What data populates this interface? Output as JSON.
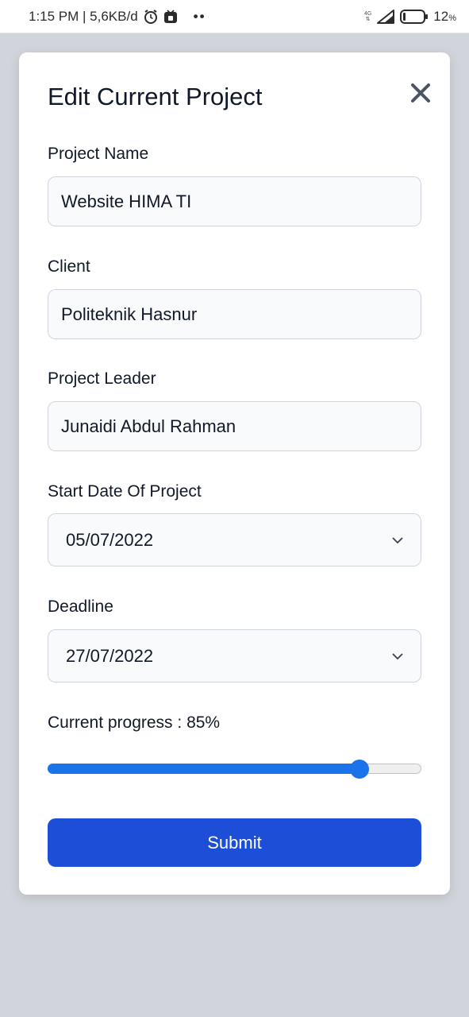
{
  "status_bar": {
    "time_speed": "1:15 PM | 5,6KB/d",
    "alarm_icon": "alarm-clock-icon",
    "app_icon": "notification-app-icon",
    "more_dots": "••",
    "network_label": "4G",
    "battery_percent": "12",
    "battery_unit": "%"
  },
  "dialog": {
    "title": "Edit Current Project",
    "close_icon": "close-icon"
  },
  "form": {
    "project_name": {
      "label": "Project Name",
      "value": "Website HIMA TI"
    },
    "client": {
      "label": "Client",
      "value": "Politeknik Hasnur"
    },
    "project_leader": {
      "label": "Project Leader",
      "value": "Junaidi Abdul Rahman"
    },
    "start_date": {
      "label": "Start Date Of Project",
      "value": "05/07/2022"
    },
    "deadline": {
      "label": "Deadline",
      "value": "27/07/2022"
    },
    "progress": {
      "label": "Current progress : 85%",
      "value_percent": 85
    },
    "submit_label": "Submit"
  },
  "colors": {
    "accent": "#1a73e8",
    "button": "#1d4ed8",
    "backdrop": "#d1d5db"
  }
}
